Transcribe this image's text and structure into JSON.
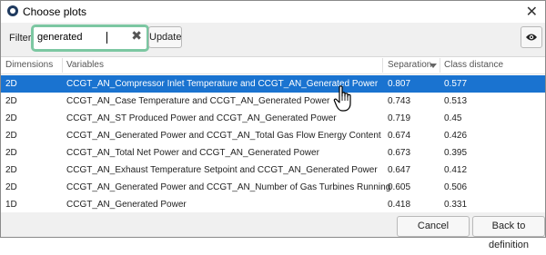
{
  "window": {
    "title": "Choose plots",
    "close_glyph": "✕",
    "app_icon": "app-logo-icon"
  },
  "filter": {
    "label": "Filter:",
    "value": "generated",
    "clear_glyph": "✖",
    "update_label": "Update",
    "visibility_icon": "eye-icon"
  },
  "columns": [
    {
      "label": "Dimensions"
    },
    {
      "label": "Variables"
    },
    {
      "label": "Separation",
      "sort": "descending"
    },
    {
      "label": "Class distance"
    }
  ],
  "rows": [
    {
      "dim": "2D",
      "vars": "CCGT_AN_Compressor Inlet Temperature and CCGT_AN_Generated Power",
      "sep": "0.807",
      "cls": "0.577",
      "selected": true
    },
    {
      "dim": "2D",
      "vars": "CCGT_AN_Case Temperature and CCGT_AN_Generated Power",
      "sep": "0.743",
      "cls": "0.513"
    },
    {
      "dim": "2D",
      "vars": "CCGT_AN_ST Produced Power and CCGT_AN_Generated Power",
      "sep": "0.719",
      "cls": "0.45"
    },
    {
      "dim": "2D",
      "vars": "CCGT_AN_Generated Power and CCGT_AN_Total Gas Flow Energy Content",
      "sep": "0.674",
      "cls": "0.426"
    },
    {
      "dim": "2D",
      "vars": "CCGT_AN_Total Net Power and CCGT_AN_Generated Power",
      "sep": "0.673",
      "cls": "0.395"
    },
    {
      "dim": "2D",
      "vars": "CCGT_AN_Exhaust Temperature Setpoint and CCGT_AN_Generated Power",
      "sep": "0.647",
      "cls": "0.412"
    },
    {
      "dim": "2D",
      "vars": "CCGT_AN_Generated Power and CCGT_AN_Number of Gas Turbines Running",
      "sep": "0.605",
      "cls": "0.506"
    },
    {
      "dim": "1D",
      "vars": "CCGT_AN_Generated Power",
      "sep": "0.418",
      "cls": "0.331"
    }
  ],
  "footer": {
    "cancel_label": "Cancel",
    "back_label": "Back to definition"
  },
  "colors": {
    "selection": "#1a73d0",
    "search_border": "#7cc7a2"
  }
}
